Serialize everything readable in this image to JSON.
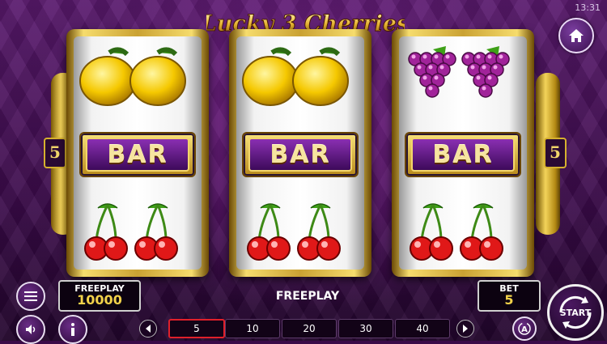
{
  "status_bar": {
    "time": "13:31"
  },
  "game": {
    "title": "Lucky 3 Cherries"
  },
  "paylines": {
    "left": "5",
    "right": "5"
  },
  "reels": [
    {
      "symbols": [
        "lemon",
        "bar",
        "cherry"
      ]
    },
    {
      "symbols": [
        "lemon",
        "bar",
        "cherry"
      ]
    },
    {
      "symbols": [
        "grapes",
        "bar",
        "cherry"
      ]
    }
  ],
  "bar_label": "BAR",
  "freeplay_box": {
    "label": "FREEPLAY",
    "value": "10000"
  },
  "center_message": "FREEPLAY",
  "bet_box": {
    "label": "BET",
    "value": "5"
  },
  "bet_options": [
    "5",
    "10",
    "20",
    "30",
    "40"
  ],
  "selected_bet": "5",
  "start_button": {
    "label": "START"
  },
  "icons": {
    "home": "home-icon",
    "menu": "menu-icon",
    "sound": "speaker-icon",
    "info": "info-icon",
    "autoplay": "autoplay-icon",
    "prev": "chevron-left-icon",
    "next": "chevron-right-icon"
  },
  "colors": {
    "gold": "#f2d24a",
    "purple": "#3a0a48",
    "selected_border": "#e0202a"
  }
}
